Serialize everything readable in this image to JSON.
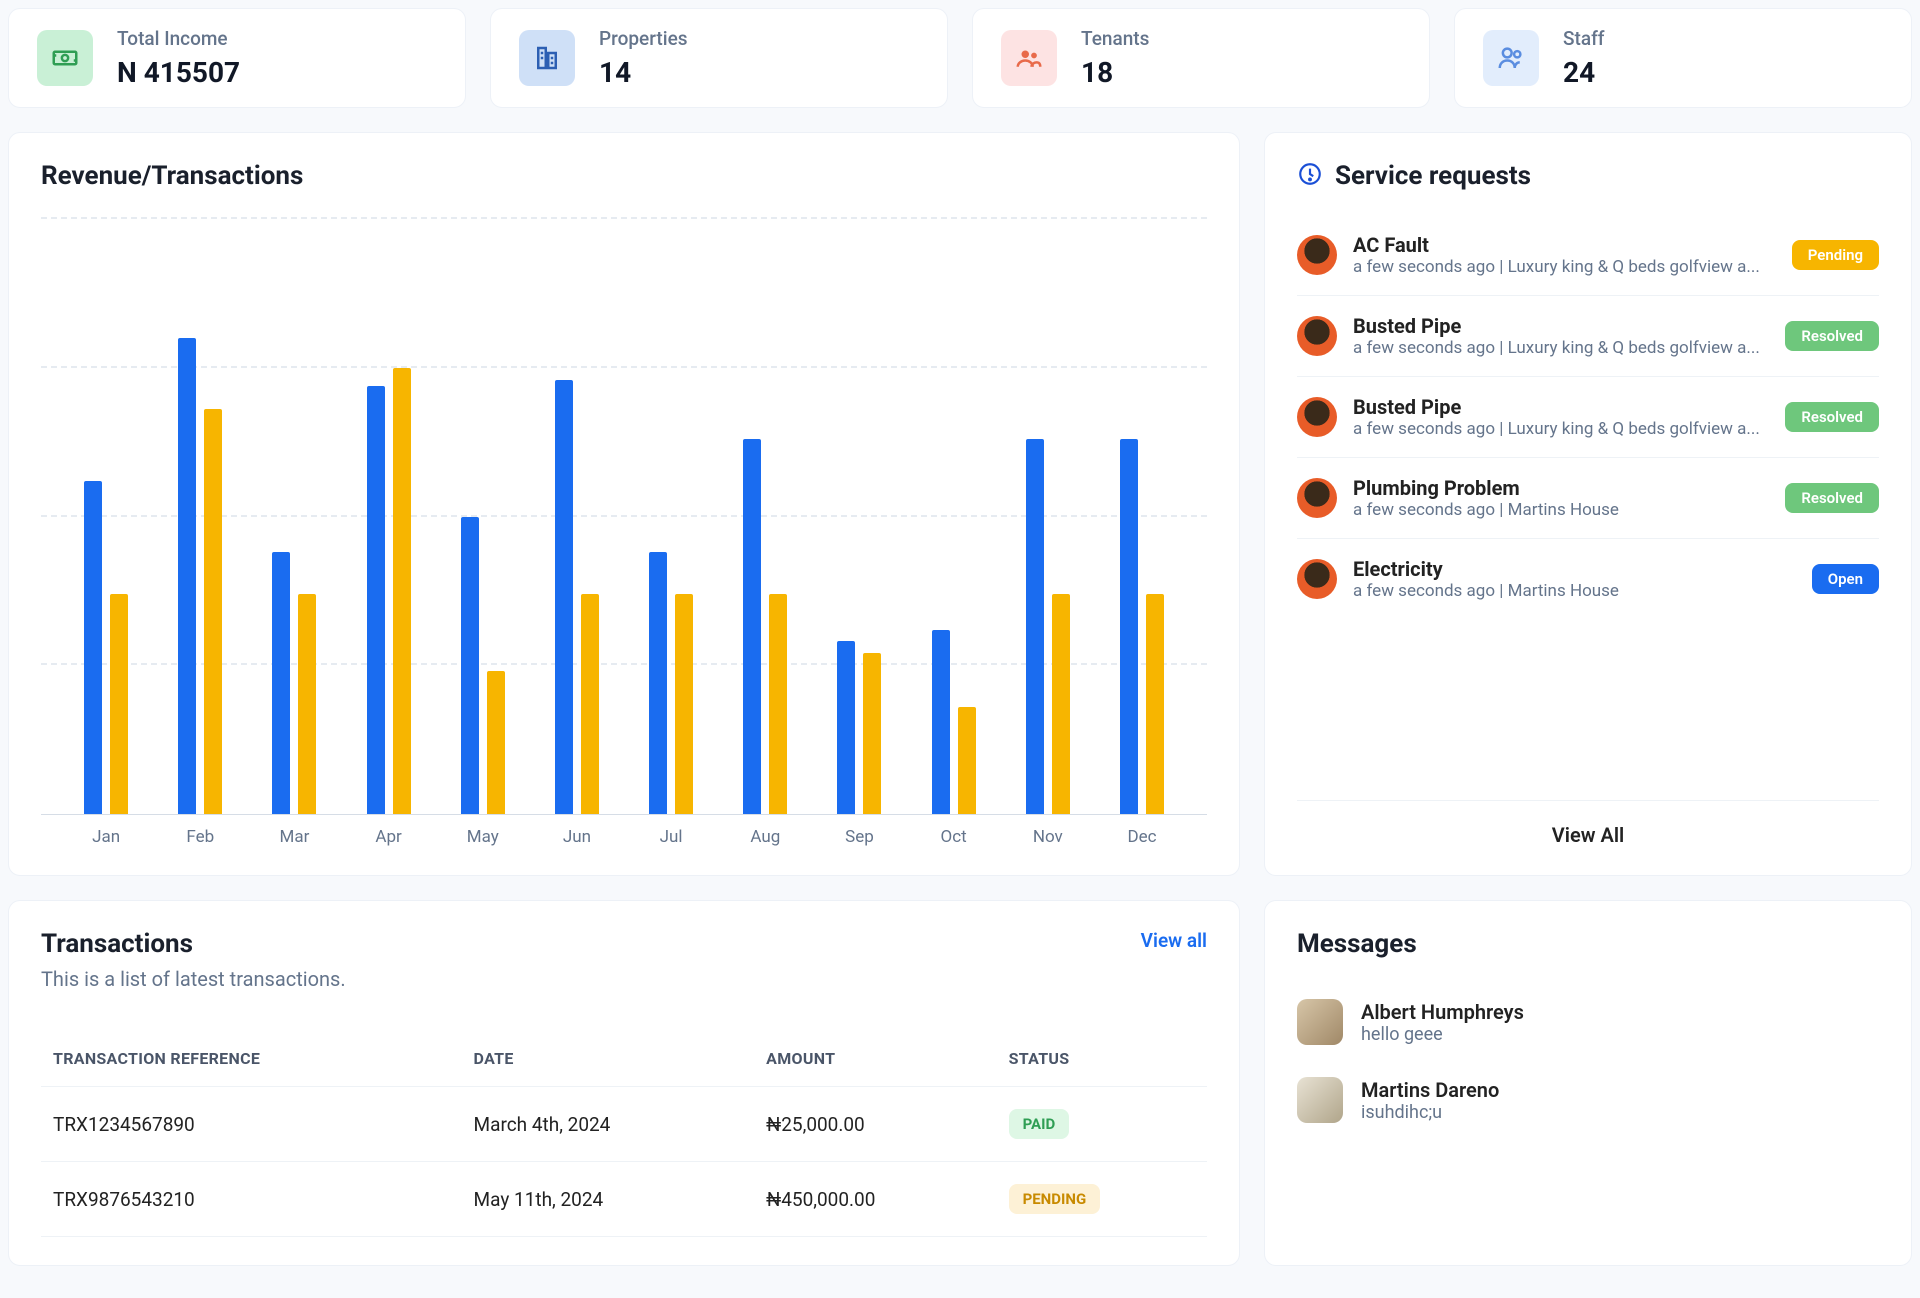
{
  "stats": [
    {
      "label": "Total Income",
      "value": "N 415507",
      "icon": "cash-icon",
      "iconClass": "icon-green"
    },
    {
      "label": "Properties",
      "value": "14",
      "icon": "building-icon",
      "iconClass": "icon-blue"
    },
    {
      "label": "Tenants",
      "value": "18",
      "icon": "group-icon",
      "iconClass": "icon-pink"
    },
    {
      "label": "Staff",
      "value": "24",
      "icon": "person-icon",
      "iconClass": "icon-lblue"
    }
  ],
  "chart_data": {
    "type": "bar",
    "title": "Revenue/Transactions",
    "categories": [
      "Jan",
      "Feb",
      "Mar",
      "Apr",
      "May",
      "Jun",
      "Jul",
      "Aug",
      "Sep",
      "Oct",
      "Nov",
      "Dec"
    ],
    "series": [
      {
        "name": "Revenue",
        "color": "#1a6cf0",
        "values": [
          56,
          80,
          44,
          72,
          50,
          73,
          44,
          63,
          29,
          31,
          63,
          63
        ]
      },
      {
        "name": "Transactions",
        "color": "#f7b500",
        "values": [
          37,
          68,
          37,
          75,
          24,
          37,
          37,
          37,
          27,
          18,
          37,
          37
        ]
      }
    ],
    "ylim": [
      0,
      100
    ],
    "gridlines": [
      0,
      25,
      50,
      75,
      100
    ]
  },
  "service_requests": {
    "title": "Service requests",
    "view_all_label": "View All",
    "items": [
      {
        "title": "AC Fault",
        "meta": "a few seconds ago | Luxury king & Q beds golfview a...",
        "status": "Pending",
        "statusClass": "pending"
      },
      {
        "title": "Busted Pipe",
        "meta": "a few seconds ago | Luxury king & Q beds golfview a...",
        "status": "Resolved",
        "statusClass": "resolved"
      },
      {
        "title": "Busted Pipe",
        "meta": "a few seconds ago | Luxury king & Q beds golfview a...",
        "status": "Resolved",
        "statusClass": "resolved"
      },
      {
        "title": "Plumbing Problem",
        "meta": "a few seconds ago | Martins House",
        "status": "Resolved",
        "statusClass": "resolved"
      },
      {
        "title": "Electricity",
        "meta": "a few seconds ago | Martins House",
        "status": "Open",
        "statusClass": "open"
      }
    ]
  },
  "transactions": {
    "title": "Transactions",
    "subtitle": "This is a list of latest transactions.",
    "view_all_label": "View all",
    "columns": [
      "TRANSACTION REFERENCE",
      "DATE",
      "AMOUNT",
      "STATUS"
    ],
    "rows": [
      {
        "ref": "TRX1234567890",
        "date": "March 4th, 2024",
        "amount": "₦25,000.00",
        "status": "PAID",
        "statusClass": "paid"
      },
      {
        "ref": "TRX9876543210",
        "date": "May 11th, 2024",
        "amount": "₦450,000.00",
        "status": "PENDING",
        "statusClass": "pending"
      }
    ]
  },
  "messages": {
    "title": "Messages",
    "items": [
      {
        "name": "Albert Humphreys",
        "text": "hello geee",
        "avatarClass": ""
      },
      {
        "name": "Martins Dareno",
        "text": "isuhdihc;u",
        "avatarClass": "alt"
      }
    ]
  }
}
